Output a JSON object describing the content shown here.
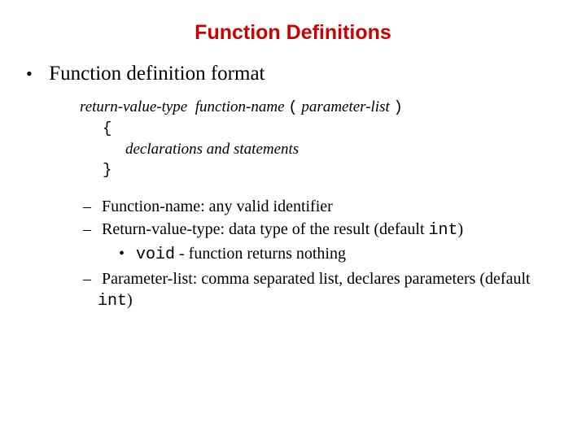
{
  "title": "Function Definitions",
  "bullet1": "Function definition format",
  "code": {
    "sig_rvt": "return-value-type",
    "sig_fn": "function-name",
    "sig_lp": "(",
    "sig_pl": "parameter-list",
    "sig_rp": ")",
    "open": "{",
    "body": "declarations and statements",
    "close": "}"
  },
  "items": {
    "fn_name": "Function-name: any valid identifier",
    "rvt_pre": "Return-value-type: data type of the result (default ",
    "rvt_code": "int",
    "rvt_post": ")",
    "void_code": "void",
    "void_text": " - function returns nothing",
    "pl_pre": "Parameter-list: comma separated list, declares parameters (default ",
    "pl_code": "int",
    "pl_post": ")"
  }
}
